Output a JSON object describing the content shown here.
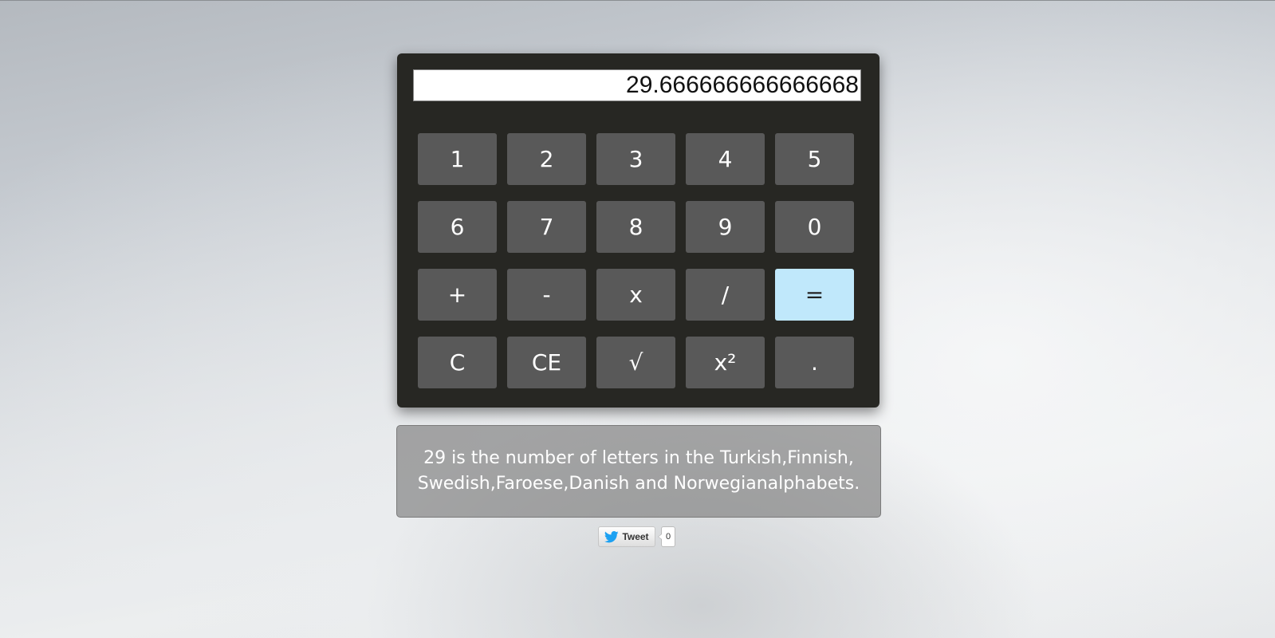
{
  "calculator": {
    "display_value": "29.666666666666668",
    "keys": [
      {
        "label": "1",
        "name": "key-1"
      },
      {
        "label": "2",
        "name": "key-2"
      },
      {
        "label": "3",
        "name": "key-3"
      },
      {
        "label": "4",
        "name": "key-4"
      },
      {
        "label": "5",
        "name": "key-5"
      },
      {
        "label": "6",
        "name": "key-6"
      },
      {
        "label": "7",
        "name": "key-7"
      },
      {
        "label": "8",
        "name": "key-8"
      },
      {
        "label": "9",
        "name": "key-9"
      },
      {
        "label": "0",
        "name": "key-0"
      },
      {
        "label": "+",
        "name": "add-button"
      },
      {
        "label": "-",
        "name": "subtract-button"
      },
      {
        "label": "x",
        "name": "multiply-button"
      },
      {
        "label": "/",
        "name": "divide-button"
      },
      {
        "label": "=",
        "name": "equals-button"
      },
      {
        "label": "C",
        "name": "clear-button"
      },
      {
        "label": "CE",
        "name": "clear-entry-button"
      },
      {
        "label": "√",
        "name": "square-root-button"
      },
      {
        "label": "x²",
        "name": "square-button"
      },
      {
        "label": ".",
        "name": "decimal-point-button"
      }
    ]
  },
  "fact": {
    "text": "29 is the number of letters in the Turkish,Finnish, Swedish,Faroese,Danish and Norwegianalphabets."
  },
  "tweet": {
    "label": "Tweet",
    "count": "0",
    "icon": "twitter-bird-icon"
  },
  "colors": {
    "calculator_body": "#272723",
    "key_background": "#595959",
    "equals_key": "#c0e8fb",
    "twitter_blue": "#1da1f2"
  }
}
